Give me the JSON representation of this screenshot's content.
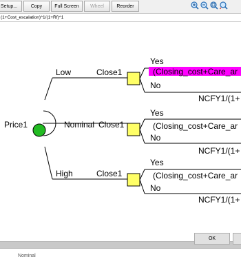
{
  "toolbar": {
    "buttons": [
      {
        "label": "Setup...",
        "enabled": true
      },
      {
        "label": "Copy",
        "enabled": true
      },
      {
        "label": "Full Screen",
        "enabled": true
      },
      {
        "label": "Wheel",
        "enabled": false
      },
      {
        "label": "Reorder",
        "enabled": true
      }
    ],
    "icons": [
      "zoom-in-icon",
      "zoom-out-icon",
      "zoom-fit-icon",
      "zoom-reset-icon"
    ]
  },
  "formula": "(1+Cost_escalation)^1/(1+Rf)^1",
  "tree": {
    "root_label": "Price1",
    "branches": [
      {
        "state": "Low",
        "decision": "Close1",
        "yes": "Yes",
        "formula": "(Closing_cost+Care_ar",
        "no": "No",
        "value": "NCFY1/(1+",
        "highlighted": true
      },
      {
        "state": "Nominal",
        "decision": "Close1",
        "yes": "Yes",
        "formula": "(Closing_cost+Care_ar",
        "no": "No",
        "value": "NCFY1/(1+",
        "highlighted": false
      },
      {
        "state": "High",
        "decision": "Close1",
        "yes": "Yes",
        "formula": "(Closing_cost+Care_ar",
        "no": "No",
        "value": "NCFY1/(1+",
        "highlighted": false
      }
    ],
    "colors": {
      "chance_node": "#22bb22",
      "decision_node": "#ffff66",
      "highlight": "#ff00ff"
    }
  },
  "dialog": {
    "ok_label": "OK",
    "partial_text": "Nominal"
  }
}
